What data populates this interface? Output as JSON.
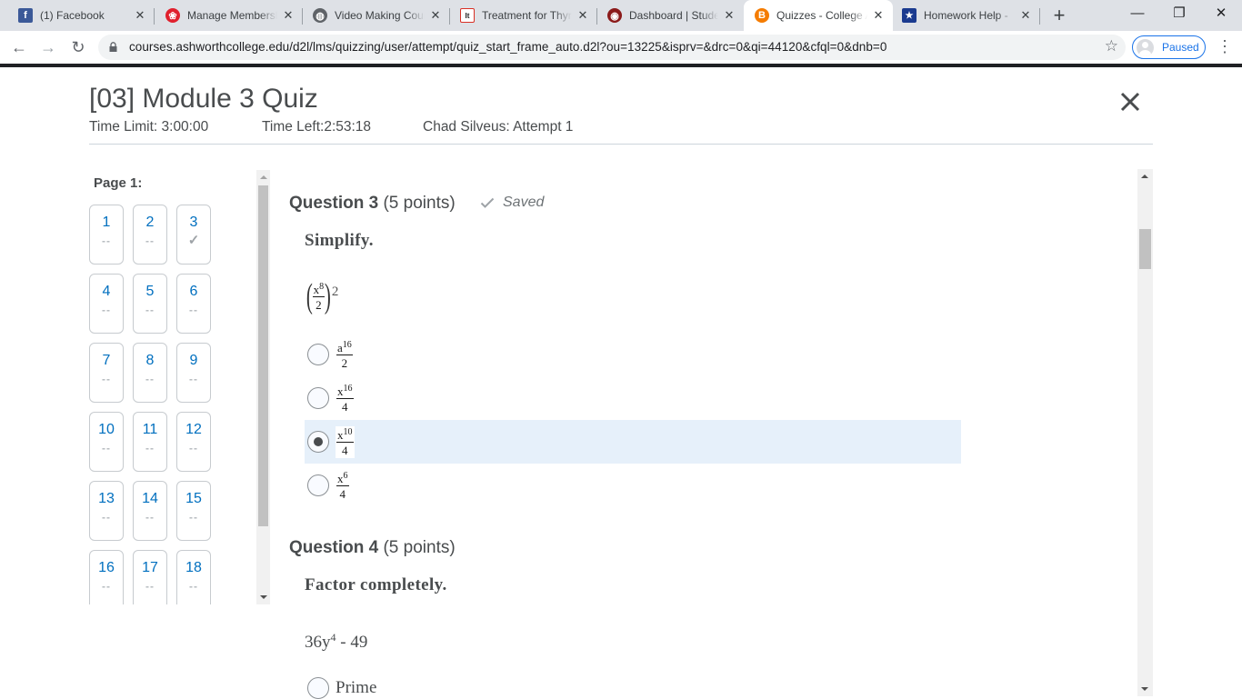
{
  "browser": {
    "tabs": [
      {
        "title": "(1) Facebook",
        "icon": "facebook-icon",
        "color": "#3b5998",
        "glyph": "f",
        "active": false
      },
      {
        "title": "Manage Membership",
        "icon": "rose-icon",
        "color": "#e0202d",
        "glyph": "❀",
        "active": false
      },
      {
        "title": "Video Making Course",
        "icon": "globe-icon",
        "color": "#5f6368",
        "glyph": "◍",
        "active": false
      },
      {
        "title": "Treatment for Thyroid",
        "icon": "itm-icon",
        "color": "#d93025",
        "glyph": "It",
        "active": false
      },
      {
        "title": "Dashboard | Student",
        "icon": "seal-icon",
        "color": "#8b1a1a",
        "glyph": "◉",
        "active": false
      },
      {
        "title": "Quizzes - College A",
        "icon": "brightspace-icon",
        "color": "#f57c00",
        "glyph": "B",
        "active": true
      },
      {
        "title": "Homework Help - ",
        "icon": "star-shield-icon",
        "color": "#1a3a8f",
        "glyph": "★",
        "active": false
      }
    ],
    "new_tab": "+",
    "url": "courses.ashworthcollege.edu/d2l/lms/quizzing/user/attempt/quiz_start_frame_auto.d2l?ou=13225&isprv=&drc=0&qi=44120&cfql=0&dnb=0",
    "profile_label": "Paused",
    "window": {
      "minimize": "—",
      "restore": "❐",
      "close": "✕"
    }
  },
  "quiz": {
    "title": "[03] Module 3 Quiz",
    "time_limit": "Time Limit: 3:00:00",
    "time_left": "Time Left:2:53:18",
    "attempt": "Chad Silveus: Attempt 1"
  },
  "nav": {
    "page_label": "Page 1:",
    "questions": [
      {
        "n": "1",
        "status": "--"
      },
      {
        "n": "2",
        "status": "--"
      },
      {
        "n": "3",
        "status": "✓"
      },
      {
        "n": "4",
        "status": "--"
      },
      {
        "n": "5",
        "status": "--"
      },
      {
        "n": "6",
        "status": "--"
      },
      {
        "n": "7",
        "status": "--"
      },
      {
        "n": "8",
        "status": "--"
      },
      {
        "n": "9",
        "status": "--"
      },
      {
        "n": "10",
        "status": "--"
      },
      {
        "n": "11",
        "status": "--"
      },
      {
        "n": "12",
        "status": "--"
      },
      {
        "n": "13",
        "status": "--"
      },
      {
        "n": "14",
        "status": "--"
      },
      {
        "n": "15",
        "status": "--"
      },
      {
        "n": "16",
        "status": "--"
      },
      {
        "n": "17",
        "status": "--"
      },
      {
        "n": "18",
        "status": "--"
      }
    ]
  },
  "q3": {
    "label": "Question 3",
    "points": "(5 points)",
    "saved": "Saved",
    "prompt": "Simplify.",
    "expr": {
      "num_base": "x",
      "num_exp": "8",
      "den": "2",
      "power": "2"
    },
    "options": [
      {
        "base": "a",
        "exp": "16",
        "den": "2",
        "selected": false
      },
      {
        "base": "x",
        "exp": "16",
        "den": "4",
        "selected": false
      },
      {
        "base": "x",
        "exp": "10",
        "den": "4",
        "selected": true
      },
      {
        "base": "x",
        "exp": "6",
        "den": "4",
        "selected": false
      }
    ]
  },
  "q4": {
    "label": "Question 4",
    "points": "(5 points)",
    "prompt": "Factor completely.",
    "expr_base": "36y",
    "expr_exp": "4",
    "expr_rest": " - 49",
    "first_option": "Prime"
  }
}
